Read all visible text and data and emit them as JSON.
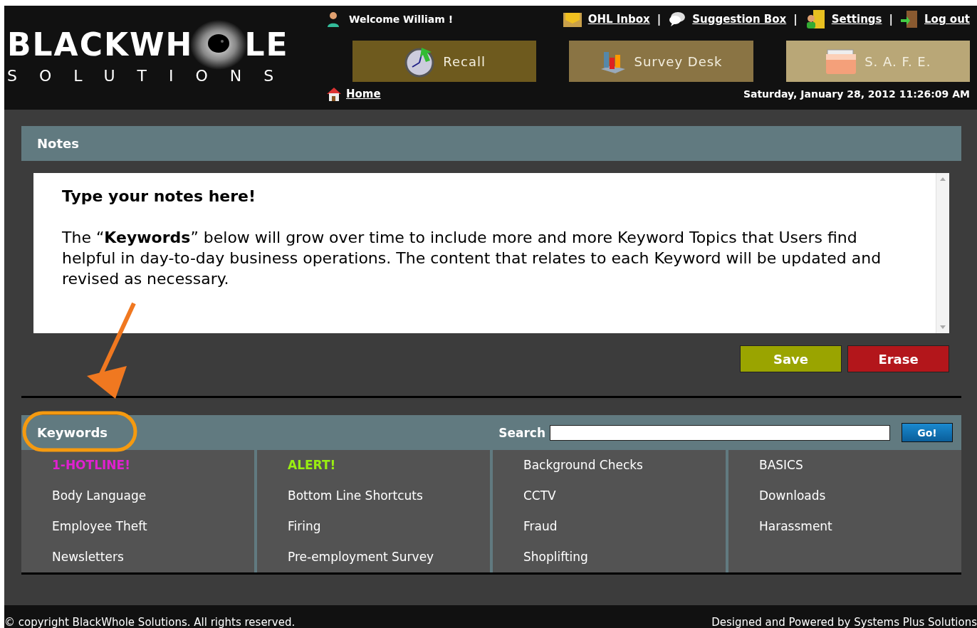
{
  "logo": {
    "word_left": "BLACKWH",
    "word_right": "LE",
    "tagline": "SOLUTIONS"
  },
  "welcome": "Welcome William !",
  "top_links": [
    {
      "kind": "inbox",
      "label": "OHL Inbox"
    },
    {
      "kind": "suggestion",
      "label": "Suggestion Box"
    },
    {
      "kind": "settings",
      "label": "Settings"
    },
    {
      "kind": "logout",
      "label": "Log out"
    }
  ],
  "separators": [
    "|",
    "|",
    "|"
  ],
  "nav_buttons": [
    {
      "kind": "recall",
      "label": "Recall",
      "color": "#6e5a1e"
    },
    {
      "kind": "survey",
      "label": "Survey Desk",
      "color": "#8a7444"
    },
    {
      "kind": "safe",
      "label": "S. A. F. E.",
      "color": "#b9a777"
    }
  ],
  "home": "Home",
  "datetime": "Saturday, January 28, 2012 11:26:09 AM",
  "notes": {
    "title": "Notes",
    "heading": "Type your notes here!",
    "body": "The “**Keywords**” below will grow over time to include more and more Keyword Topics that Users find helpful in day-to-day business operations. The content that relates to each Keyword will be updated and revised as necessary.",
    "buttons": [
      {
        "kind": "save",
        "label": "Save"
      },
      {
        "kind": "erase",
        "label": "Erase"
      }
    ]
  },
  "keywords": {
    "title": "Keywords",
    "search_label": "Search",
    "go": "Go!",
    "columns": [
      [
        {
          "label": "1-HOTLINE!",
          "color": "#e020d0"
        },
        {
          "label": "Body Language",
          "color": "#ffffff"
        },
        {
          "label": "Employee Theft",
          "color": "#ffffff"
        },
        {
          "label": "Newsletters",
          "color": "#ffffff"
        }
      ],
      [
        {
          "label": "ALERT!",
          "color": "#99ee11"
        },
        {
          "label": "Bottom Line Shortcuts",
          "color": "#ffffff"
        },
        {
          "label": "Firing",
          "color": "#ffffff"
        },
        {
          "label": "Pre-employment Survey",
          "color": "#ffffff"
        }
      ],
      [
        {
          "label": "Background Checks",
          "color": "#ffffff"
        },
        {
          "label": "CCTV",
          "color": "#ffffff"
        },
        {
          "label": "Fraud",
          "color": "#ffffff"
        },
        {
          "label": "Shoplifting",
          "color": "#ffffff"
        }
      ],
      [
        {
          "label": "BASICS",
          "color": "#ffffff"
        },
        {
          "label": "Downloads",
          "color": "#ffffff"
        },
        {
          "label": "Harassment",
          "color": "#ffffff"
        }
      ]
    ]
  },
  "footer": {
    "copyright": "© copyright BlackWhole Solutions. All rights reserved.",
    "credit": "Designed and Powered by Systems Plus Solutions"
  }
}
